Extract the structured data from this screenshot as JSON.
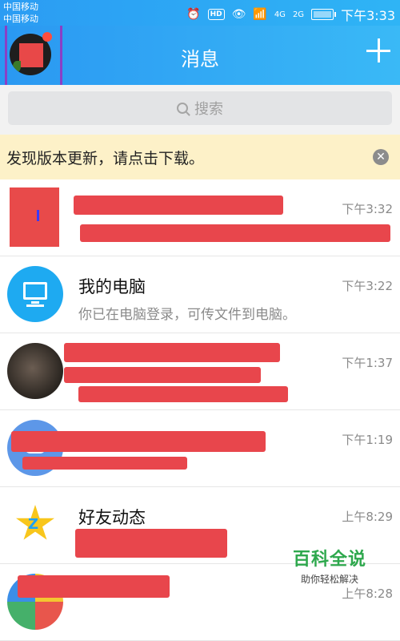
{
  "status_bar": {
    "carrier_1": "中国移动",
    "carrier_2": "中国移动",
    "hd": "HD",
    "net_1": "4G",
    "net_2": "2G",
    "time": "下午3:33"
  },
  "header": {
    "title": "消息"
  },
  "search": {
    "placeholder": "搜索"
  },
  "update_banner": {
    "text": "发现版本更新，请点击下载。"
  },
  "chats": [
    {
      "name": "",
      "message": "",
      "time": "下午3:32"
    },
    {
      "name": "我的电脑",
      "message": "你已在电脑登录，可传文件到电脑。",
      "time": "下午3:22"
    },
    {
      "name": "",
      "message": "",
      "time": "下午1:37"
    },
    {
      "name": "",
      "message": "",
      "time": "下午1:19"
    },
    {
      "name": "好友动态",
      "message": "",
      "time": "上午8:29"
    },
    {
      "name": "",
      "message": "",
      "time": "上午8:28"
    }
  ],
  "watermark": {
    "title": "百科全说",
    "subtitle": "助你轻松解决"
  }
}
